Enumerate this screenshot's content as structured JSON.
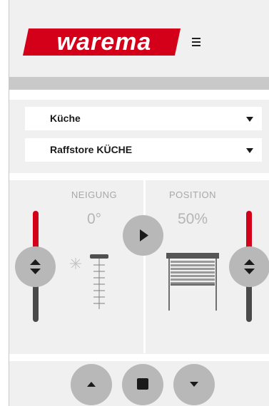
{
  "header": {
    "logo_text": "warema",
    "brand_color": "#d4001a",
    "menu_icon": "hamburger-menu-icon"
  },
  "selectors": {
    "room": "Küche",
    "device": "Raffstore KÜCHE"
  },
  "tilt": {
    "title": "NEIGUNG",
    "value": "0°"
  },
  "position": {
    "title": "POSITION",
    "value": "50%"
  },
  "controls": {
    "play_icon": "play-icon",
    "up_icon": "arrow-up-icon",
    "stop_icon": "stop-icon",
    "down_icon": "arrow-down-icon",
    "slider_handle_icon": "up-down-arrows-icon"
  },
  "colors": {
    "accent": "#d4001a",
    "track_dark": "#4a4a4a",
    "button_gray": "#b8b8b8"
  }
}
